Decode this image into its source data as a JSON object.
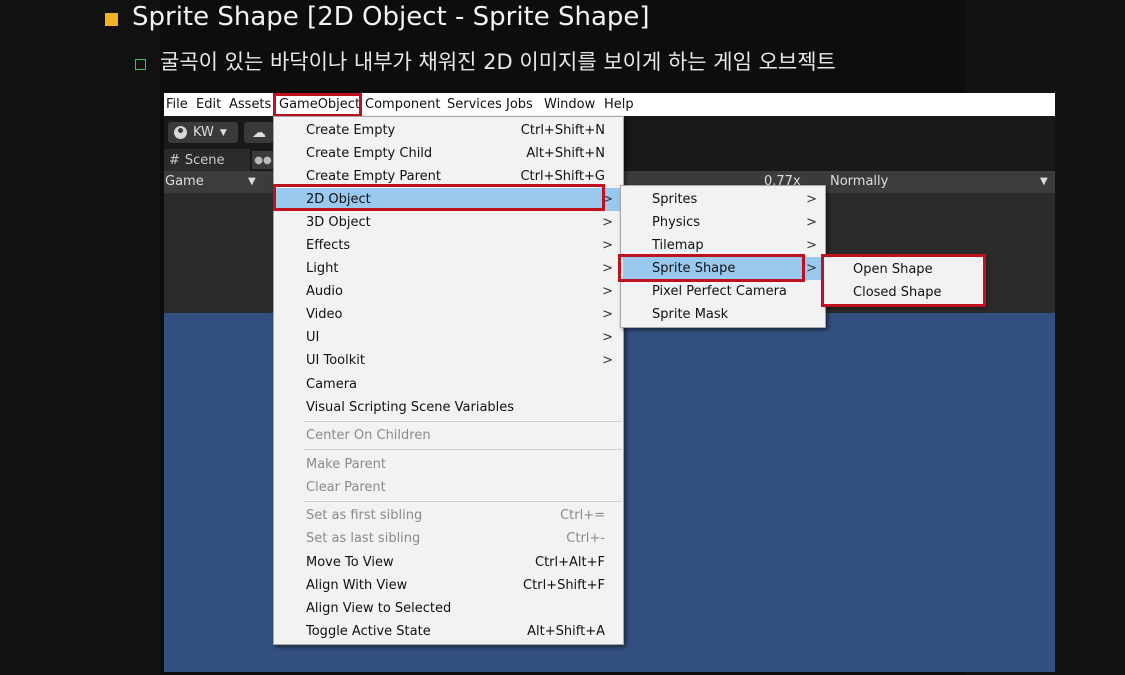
{
  "slide": {
    "title": "Sprite Shape [2D Object - Sprite Shape]",
    "subtitle": "굴곡이 있는 바닥이나 내부가 채워진 2D 이미지를 보이게 하는 게임 오브젝트"
  },
  "colors": {
    "title_bullet": "#f0b323",
    "sub_bullet": "#34c759",
    "highlight": "#99c9ef",
    "callout": "#c0111f",
    "game_view": "#345080"
  },
  "menubar": {
    "items": [
      "File",
      "Edit",
      "Assets",
      "GameObject",
      "Component",
      "Services",
      "Jobs",
      "Window",
      "Help"
    ]
  },
  "toolbar": {
    "account": "KW",
    "account_icon": "person-icon",
    "cloud_icon": "cloud-icon"
  },
  "tabs": {
    "scene": "Scene",
    "scene_icon": "hash-icon",
    "game_icon": "gamepad-icon"
  },
  "game_bar": {
    "display": "Game",
    "scale": "0.77x",
    "mode": "Normally"
  },
  "gameobject_menu": {
    "items": [
      {
        "label": "Create Empty",
        "shortcut": "Ctrl+Shift+N"
      },
      {
        "label": "Create Empty Child",
        "shortcut": "Alt+Shift+N"
      },
      {
        "label": "Create Empty Parent",
        "shortcut": "Ctrl+Shift+G"
      },
      {
        "label": "2D Object",
        "submenu": ">"
      },
      {
        "label": "3D Object",
        "submenu": ">"
      },
      {
        "label": "Effects",
        "submenu": ">"
      },
      {
        "label": "Light",
        "submenu": ">"
      },
      {
        "label": "Audio",
        "submenu": ">"
      },
      {
        "label": "Video",
        "submenu": ">"
      },
      {
        "label": "UI",
        "submenu": ">"
      },
      {
        "label": "UI Toolkit",
        "submenu": ">"
      },
      {
        "label": "Camera"
      },
      {
        "label": "Visual Scripting Scene Variables"
      },
      {
        "label": "Center On Children"
      },
      {
        "label": "Make Parent"
      },
      {
        "label": "Clear Parent"
      },
      {
        "label": "Set as first sibling",
        "shortcut": "Ctrl+="
      },
      {
        "label": "Set as last sibling",
        "shortcut": "Ctrl+-"
      },
      {
        "label": "Move To View",
        "shortcut": "Ctrl+Alt+F"
      },
      {
        "label": "Align With View",
        "shortcut": "Ctrl+Shift+F"
      },
      {
        "label": "Align View to Selected"
      },
      {
        "label": "Toggle Active State",
        "shortcut": "Alt+Shift+A"
      }
    ]
  },
  "object2d_menu": {
    "items": [
      {
        "label": "Sprites",
        "submenu": ">"
      },
      {
        "label": "Physics",
        "submenu": ">"
      },
      {
        "label": "Tilemap",
        "submenu": ">"
      },
      {
        "label": "Sprite Shape",
        "submenu": ">"
      },
      {
        "label": "Pixel Perfect Camera"
      },
      {
        "label": "Sprite Mask"
      }
    ]
  },
  "spriteshape_menu": {
    "items": [
      {
        "label": "Open Shape"
      },
      {
        "label": "Closed Shape"
      }
    ]
  }
}
